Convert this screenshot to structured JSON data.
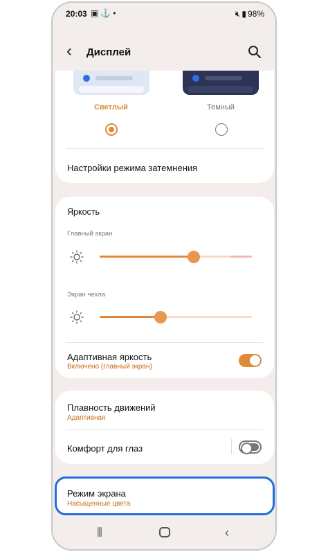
{
  "status_bar": {
    "time": "20:03",
    "left_icons": [
      "image-icon",
      "anchor-icon",
      "dot-icon"
    ],
    "right_icons": [
      "mute-icon",
      "signal-icon"
    ],
    "battery": "98%"
  },
  "header": {
    "title": "Дисплей",
    "back_icon": "chevron-left-icon",
    "search_icon": "search-icon"
  },
  "theme": {
    "light_label": "Светлый",
    "dark_label": "Темный",
    "selected": "light",
    "dark_mode_settings": "Настройки режима затемнения"
  },
  "brightness": {
    "title": "Яркость",
    "main_screen_label": "Главный экран",
    "main_screen_level": 0.62,
    "cover_screen_label": "Экран чехла",
    "cover_screen_level": 0.4,
    "adaptive_label": "Адаптивная яркость",
    "adaptive_sub": "Включено (главный экран)",
    "adaptive_on": true
  },
  "motion": {
    "smoothness_label": "Плавность движений",
    "smoothness_sub": "Адаптивная",
    "eye_comfort_label": "Комфорт для глаз",
    "eye_comfort_on": false
  },
  "screen_mode": {
    "label": "Режим экрана",
    "sub": "Насыщенные цвета"
  },
  "colors": {
    "accent": "#e0893a",
    "highlight": "#1e6ee0",
    "background": "#f3eeeb"
  }
}
